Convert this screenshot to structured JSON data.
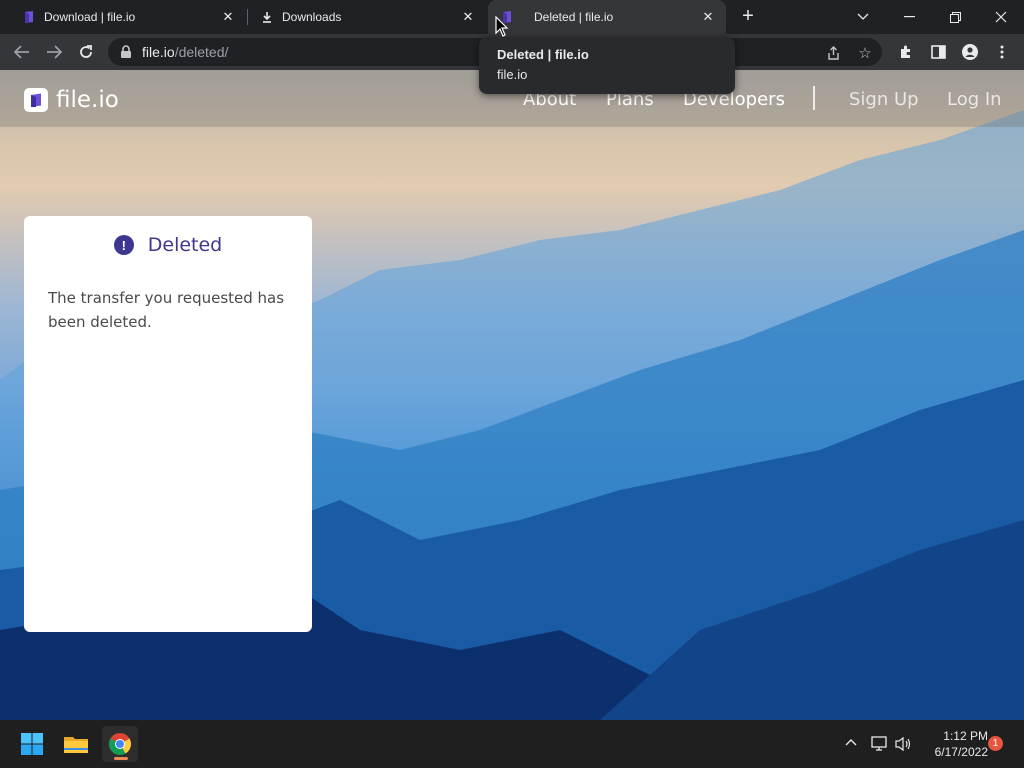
{
  "browser": {
    "tabs": [
      {
        "title": "Download | file.io"
      },
      {
        "title": "Downloads"
      },
      {
        "title": "Deleted | file.io"
      }
    ],
    "url_host": "file.io",
    "url_path": "/deleted/",
    "tooltip": {
      "title": "Deleted | file.io",
      "subtitle": "file.io"
    }
  },
  "site": {
    "logo_text": "file.io",
    "nav": {
      "about": "About",
      "plans": "Plans",
      "developers": "Developers",
      "sign_up": "Sign Up",
      "log_in": "Log In"
    },
    "card": {
      "title": "Deleted",
      "message": "The transfer you requested has been deleted."
    },
    "colors": {
      "brand": "#3e3790"
    }
  },
  "taskbar": {
    "time": "1:12 PM",
    "date": "6/17/2022",
    "notification_count": "1"
  }
}
